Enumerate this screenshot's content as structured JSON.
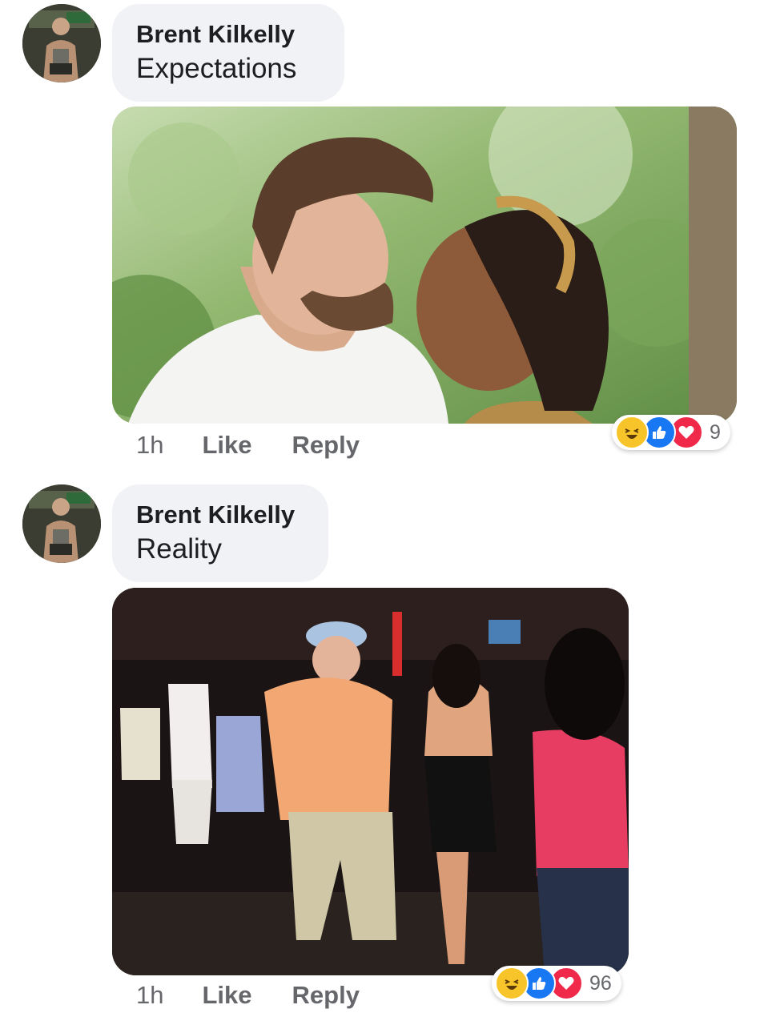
{
  "comments": [
    {
      "author": "Brent Kilkelly",
      "text": "Expectations",
      "time": "1h",
      "like_label": "Like",
      "reply_label": "Reply",
      "reaction_count": "9",
      "reactions": [
        "haha-icon",
        "like-icon",
        "love-icon"
      ]
    },
    {
      "author": "Brent Kilkelly",
      "text": "Reality",
      "time": "1h",
      "like_label": "Like",
      "reply_label": "Reply",
      "reaction_count": "96",
      "reactions": [
        "haha-icon",
        "like-icon",
        "love-icon"
      ]
    }
  ],
  "colors": {
    "bubble": "#f0f2f5",
    "text": "#1c1e21",
    "meta": "#65676b",
    "like_blue": "#1877f2",
    "love_red": "#f0284a",
    "haha_yellow": "#f7c52a"
  }
}
